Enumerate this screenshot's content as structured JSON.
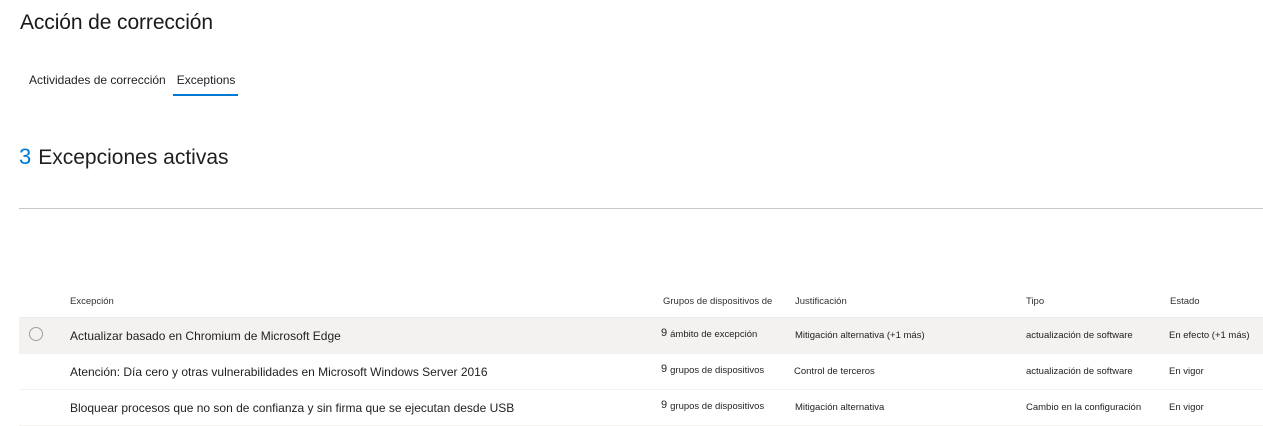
{
  "page": {
    "title": "Acción de corrección"
  },
  "tabs": [
    {
      "label": "Actividades de corrección",
      "active": false
    },
    {
      "label": "Exceptions",
      "active": true
    }
  ],
  "summary": {
    "count": "3",
    "label": "Excepciones activas"
  },
  "table": {
    "columns": {
      "exception": "Excepción",
      "groups": "Grupos de dispositivos de",
      "justification": "Justificación",
      "type": "Tipo",
      "status": "Estado"
    },
    "rows": [
      {
        "name": "Actualizar basado en Chromium de Microsoft Edge",
        "groups_count": "9",
        "groups_text": "ámbito de excepción",
        "justification": "Mitigación alternativa (+1 más)",
        "type": "actualización de software",
        "status": "En efecto (+1 más)"
      },
      {
        "name": "Atención: Día cero y otras vulnerabilidades en Microsoft Windows Server 2016",
        "groups_count": "9",
        "groups_text": "grupos de dispositivos",
        "justification": "Control de terceros",
        "type": "actualización de software",
        "status": "En vigor"
      },
      {
        "name": "Bloquear procesos que no son de confianza y sin firma que se ejecutan desde USB",
        "groups_count": "9",
        "groups_text": "grupos de dispositivos",
        "justification": "Mitigación alternativa",
        "type": "Cambio en la configuración",
        "status": "En vigor"
      }
    ]
  },
  "colors": {
    "accent": "#0078d4",
    "hover_row": "#f3f2f1",
    "divider": "#c8c6c4"
  }
}
